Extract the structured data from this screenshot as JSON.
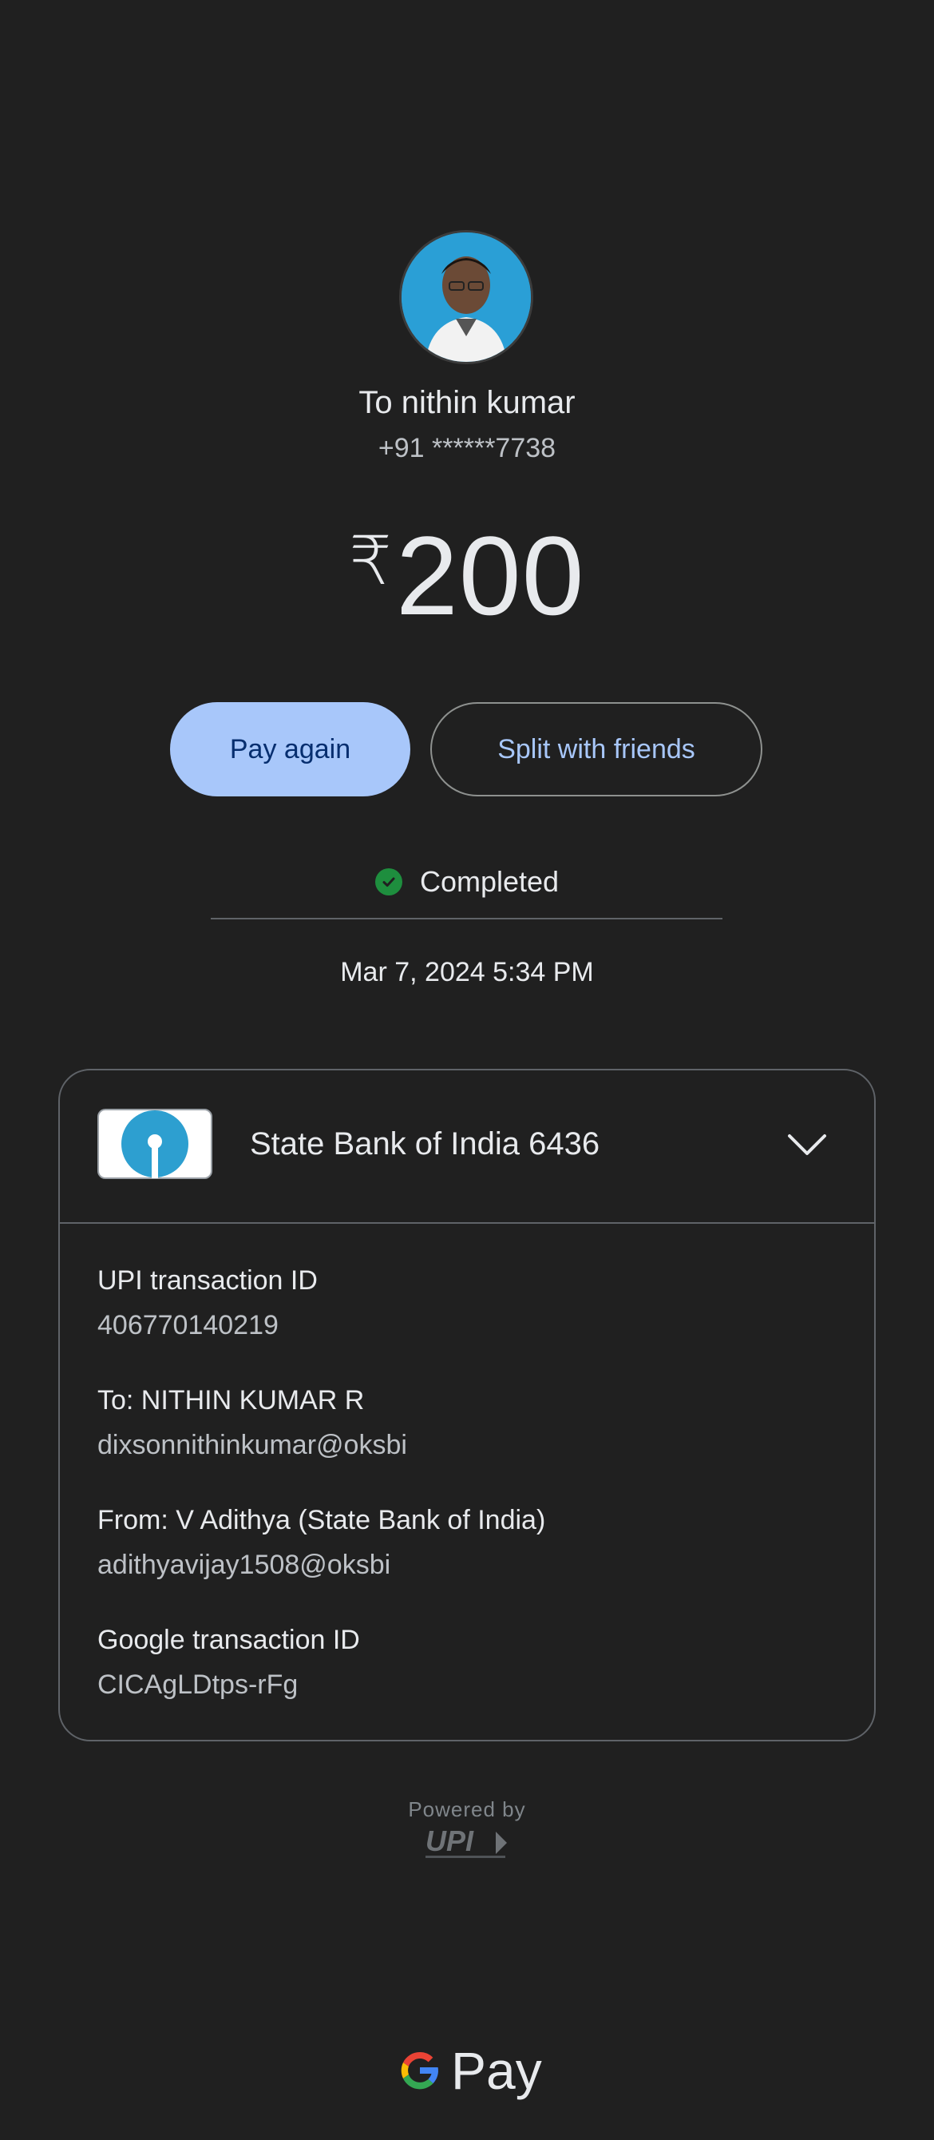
{
  "payee": {
    "name_line": "To nithin kumar",
    "phone": "+91 ******7738"
  },
  "payment": {
    "currency_symbol": "₹",
    "amount": "200"
  },
  "actions": {
    "pay_again": "Pay again",
    "split": "Split with friends"
  },
  "status": {
    "label": "Completed",
    "date": "Mar 7, 2024 5:34 PM"
  },
  "details": {
    "bank_account": "State Bank of India 6436",
    "upi_txn_label": "UPI transaction ID",
    "upi_txn_value": "406770140219",
    "to_label": "To: NITHIN KUMAR  R",
    "to_value": "dixsonnithinkumar@oksbi",
    "from_label": "From: V  Adithya (State Bank of India)",
    "from_value": "adithyavijay1508@oksbi",
    "google_txn_label": "Google transaction ID",
    "google_txn_value": "CICAgLDtps-rFg"
  },
  "footer": {
    "powered_by": "Powered by",
    "upi_logo_text": "UPI",
    "brand_text": "Pay"
  },
  "colors": {
    "background": "#202020",
    "primary_button": "#a8c7fa",
    "success": "#1e8e3e"
  }
}
